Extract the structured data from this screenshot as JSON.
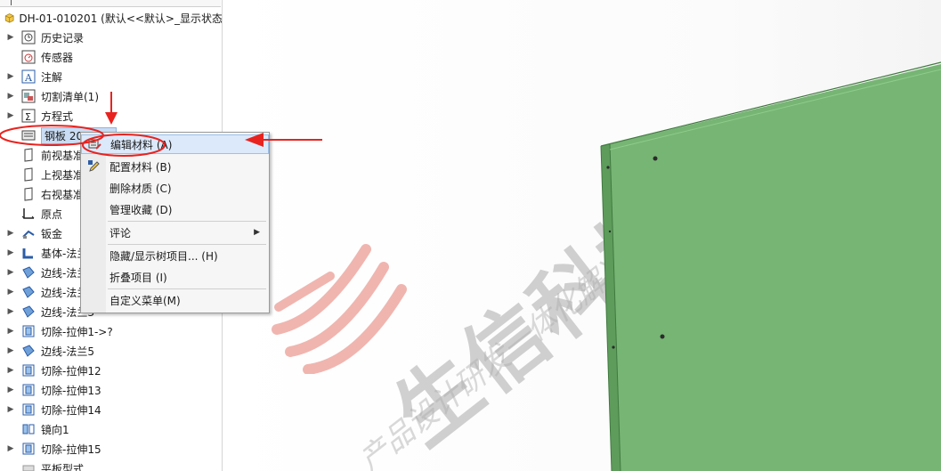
{
  "tree": {
    "title": "DH-01-010201 (默认<<默认>_显示状态",
    "items": [
      {
        "label": "历史记录",
        "icon": "history-icon",
        "expandable": true
      },
      {
        "label": "传感器",
        "icon": "sensor-icon",
        "expandable": false
      },
      {
        "label": "注解",
        "icon": "annotation-icon",
        "expandable": true
      },
      {
        "label": "切割清单(1)",
        "icon": "cut-list-icon",
        "expandable": true
      },
      {
        "label": "方程式",
        "icon": "equation-icon",
        "expandable": true
      },
      {
        "label": "钢板 20 3082",
        "icon": "material-icon",
        "expandable": false,
        "selected": true
      },
      {
        "label": "前视基准面",
        "icon": "plane-icon",
        "expandable": false
      },
      {
        "label": "上视基准面",
        "icon": "plane-icon",
        "expandable": false
      },
      {
        "label": "右视基准面",
        "icon": "plane-icon",
        "expandable": false
      },
      {
        "label": "原点",
        "icon": "origin-icon",
        "expandable": false
      },
      {
        "label": "钣金",
        "icon": "sheet-metal-icon",
        "expandable": true
      },
      {
        "label": "基体-法兰1",
        "icon": "base-flange-icon",
        "expandable": true
      },
      {
        "label": "边线-法兰1",
        "icon": "edge-flange-icon",
        "expandable": true
      },
      {
        "label": "边线-法兰2",
        "icon": "edge-flange-icon",
        "expandable": true
      },
      {
        "label": "边线-法兰3",
        "icon": "edge-flange-icon",
        "expandable": true
      },
      {
        "label": "切除-拉伸1->?",
        "icon": "cut-extrude-icon",
        "expandable": true
      },
      {
        "label": "边线-法兰5",
        "icon": "edge-flange-icon",
        "expandable": true
      },
      {
        "label": "切除-拉伸12",
        "icon": "cut-extrude-icon",
        "expandable": true
      },
      {
        "label": "切除-拉伸13",
        "icon": "cut-extrude-icon",
        "expandable": true
      },
      {
        "label": "切除-拉伸14",
        "icon": "cut-extrude-icon",
        "expandable": true
      },
      {
        "label": "镜向1",
        "icon": "mirror-icon",
        "expandable": false
      },
      {
        "label": "切除-拉伸15",
        "icon": "cut-extrude-icon",
        "expandable": true
      },
      {
        "label": "平板型式",
        "icon": "flat-pattern-icon",
        "expandable": false
      }
    ]
  },
  "context_menu": {
    "items": [
      {
        "label": "编辑材料 (A)",
        "icon": "edit-material-icon",
        "highlighted": true
      },
      {
        "label": "配置材料 (B)",
        "icon": "pencil-icon"
      },
      {
        "label": "删除材质 (C)"
      },
      {
        "label": "管理收藏 (D)"
      },
      {
        "label": "评论",
        "submenu": true
      },
      {
        "label": "隐藏/显示树项目... (H)"
      },
      {
        "label": "折叠项目 (I)"
      },
      {
        "label": "自定义菜单(M)"
      }
    ]
  },
  "watermark": {
    "main": "生信科技",
    "sub": "产品设计研发一体化解决方案"
  },
  "colors": {
    "part_green": "#76b574",
    "part_edge": "#4f8a4e",
    "annotation_red": "#e8231f",
    "menu_highlight": "#dbe9fb",
    "tree_selection": "#c9dcf3"
  }
}
